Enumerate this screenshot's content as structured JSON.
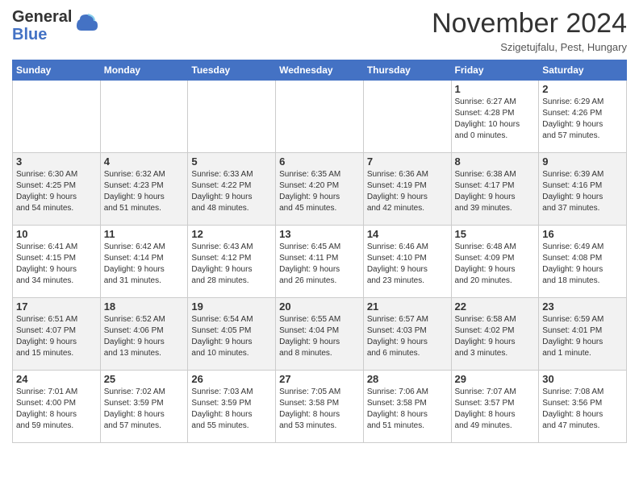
{
  "header": {
    "logo_general": "General",
    "logo_blue": "Blue",
    "month_title": "November 2024",
    "subtitle": "Szigetujfalu, Pest, Hungary"
  },
  "days_of_week": [
    "Sunday",
    "Monday",
    "Tuesday",
    "Wednesday",
    "Thursday",
    "Friday",
    "Saturday"
  ],
  "weeks": [
    [
      {
        "day": "",
        "info": ""
      },
      {
        "day": "",
        "info": ""
      },
      {
        "day": "",
        "info": ""
      },
      {
        "day": "",
        "info": ""
      },
      {
        "day": "",
        "info": ""
      },
      {
        "day": "1",
        "info": "Sunrise: 6:27 AM\nSunset: 4:28 PM\nDaylight: 10 hours\nand 0 minutes."
      },
      {
        "day": "2",
        "info": "Sunrise: 6:29 AM\nSunset: 4:26 PM\nDaylight: 9 hours\nand 57 minutes."
      }
    ],
    [
      {
        "day": "3",
        "info": "Sunrise: 6:30 AM\nSunset: 4:25 PM\nDaylight: 9 hours\nand 54 minutes."
      },
      {
        "day": "4",
        "info": "Sunrise: 6:32 AM\nSunset: 4:23 PM\nDaylight: 9 hours\nand 51 minutes."
      },
      {
        "day": "5",
        "info": "Sunrise: 6:33 AM\nSunset: 4:22 PM\nDaylight: 9 hours\nand 48 minutes."
      },
      {
        "day": "6",
        "info": "Sunrise: 6:35 AM\nSunset: 4:20 PM\nDaylight: 9 hours\nand 45 minutes."
      },
      {
        "day": "7",
        "info": "Sunrise: 6:36 AM\nSunset: 4:19 PM\nDaylight: 9 hours\nand 42 minutes."
      },
      {
        "day": "8",
        "info": "Sunrise: 6:38 AM\nSunset: 4:17 PM\nDaylight: 9 hours\nand 39 minutes."
      },
      {
        "day": "9",
        "info": "Sunrise: 6:39 AM\nSunset: 4:16 PM\nDaylight: 9 hours\nand 37 minutes."
      }
    ],
    [
      {
        "day": "10",
        "info": "Sunrise: 6:41 AM\nSunset: 4:15 PM\nDaylight: 9 hours\nand 34 minutes."
      },
      {
        "day": "11",
        "info": "Sunrise: 6:42 AM\nSunset: 4:14 PM\nDaylight: 9 hours\nand 31 minutes."
      },
      {
        "day": "12",
        "info": "Sunrise: 6:43 AM\nSunset: 4:12 PM\nDaylight: 9 hours\nand 28 minutes."
      },
      {
        "day": "13",
        "info": "Sunrise: 6:45 AM\nSunset: 4:11 PM\nDaylight: 9 hours\nand 26 minutes."
      },
      {
        "day": "14",
        "info": "Sunrise: 6:46 AM\nSunset: 4:10 PM\nDaylight: 9 hours\nand 23 minutes."
      },
      {
        "day": "15",
        "info": "Sunrise: 6:48 AM\nSunset: 4:09 PM\nDaylight: 9 hours\nand 20 minutes."
      },
      {
        "day": "16",
        "info": "Sunrise: 6:49 AM\nSunset: 4:08 PM\nDaylight: 9 hours\nand 18 minutes."
      }
    ],
    [
      {
        "day": "17",
        "info": "Sunrise: 6:51 AM\nSunset: 4:07 PM\nDaylight: 9 hours\nand 15 minutes."
      },
      {
        "day": "18",
        "info": "Sunrise: 6:52 AM\nSunset: 4:06 PM\nDaylight: 9 hours\nand 13 minutes."
      },
      {
        "day": "19",
        "info": "Sunrise: 6:54 AM\nSunset: 4:05 PM\nDaylight: 9 hours\nand 10 minutes."
      },
      {
        "day": "20",
        "info": "Sunrise: 6:55 AM\nSunset: 4:04 PM\nDaylight: 9 hours\nand 8 minutes."
      },
      {
        "day": "21",
        "info": "Sunrise: 6:57 AM\nSunset: 4:03 PM\nDaylight: 9 hours\nand 6 minutes."
      },
      {
        "day": "22",
        "info": "Sunrise: 6:58 AM\nSunset: 4:02 PM\nDaylight: 9 hours\nand 3 minutes."
      },
      {
        "day": "23",
        "info": "Sunrise: 6:59 AM\nSunset: 4:01 PM\nDaylight: 9 hours\nand 1 minute."
      }
    ],
    [
      {
        "day": "24",
        "info": "Sunrise: 7:01 AM\nSunset: 4:00 PM\nDaylight: 8 hours\nand 59 minutes."
      },
      {
        "day": "25",
        "info": "Sunrise: 7:02 AM\nSunset: 3:59 PM\nDaylight: 8 hours\nand 57 minutes."
      },
      {
        "day": "26",
        "info": "Sunrise: 7:03 AM\nSunset: 3:59 PM\nDaylight: 8 hours\nand 55 minutes."
      },
      {
        "day": "27",
        "info": "Sunrise: 7:05 AM\nSunset: 3:58 PM\nDaylight: 8 hours\nand 53 minutes."
      },
      {
        "day": "28",
        "info": "Sunrise: 7:06 AM\nSunset: 3:58 PM\nDaylight: 8 hours\nand 51 minutes."
      },
      {
        "day": "29",
        "info": "Sunrise: 7:07 AM\nSunset: 3:57 PM\nDaylight: 8 hours\nand 49 minutes."
      },
      {
        "day": "30",
        "info": "Sunrise: 7:08 AM\nSunset: 3:56 PM\nDaylight: 8 hours\nand 47 minutes."
      }
    ]
  ]
}
